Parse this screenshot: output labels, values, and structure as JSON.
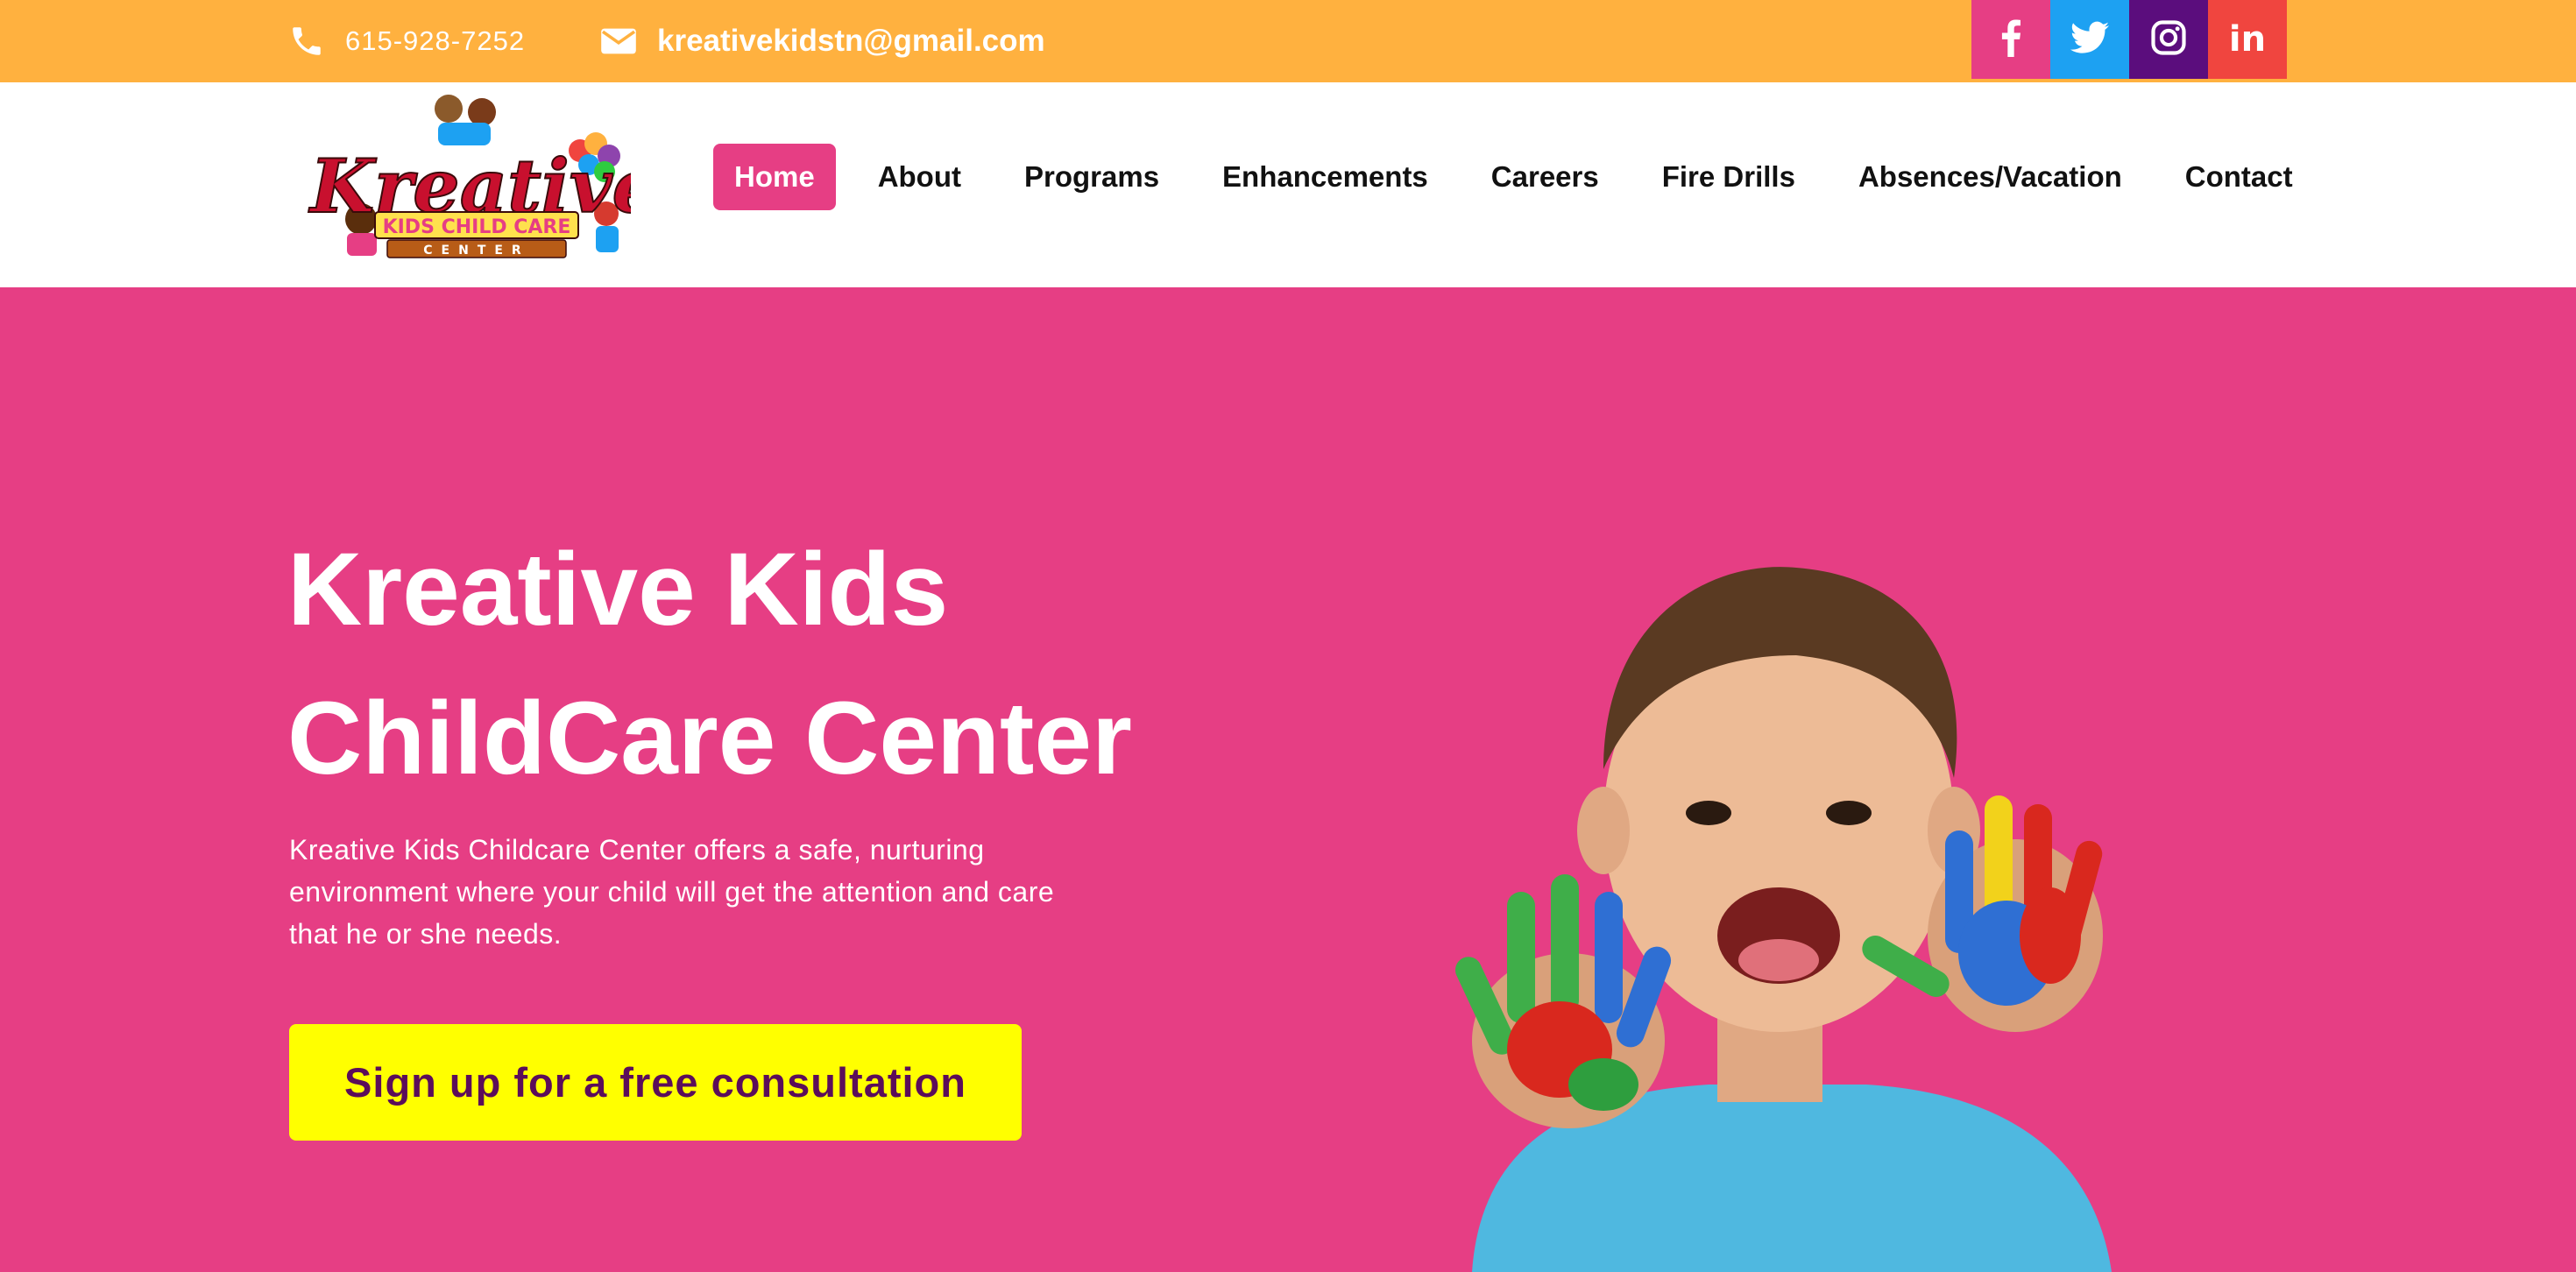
{
  "topbar": {
    "phone": "615-928-7252",
    "email": "kreativekidstn@gmail.com",
    "socials": [
      {
        "name": "facebook",
        "icon": "facebook-icon",
        "color": "#E63E84"
      },
      {
        "name": "twitter",
        "icon": "twitter-icon",
        "color": "#1DA1F2"
      },
      {
        "name": "instagram",
        "icon": "instagram-icon",
        "color": "#5B0D7D"
      },
      {
        "name": "linkedin",
        "icon": "linkedin-icon",
        "color": "#F0453F",
        "glyph": "in"
      }
    ],
    "background": "#FFB13F"
  },
  "logo": {
    "word": "Kreative",
    "line2": "KIDS CHILD CARE",
    "line3": "CENTER"
  },
  "nav": {
    "items": [
      {
        "label": "Home",
        "active": true
      },
      {
        "label": "About"
      },
      {
        "label": "Programs"
      },
      {
        "label": "Enhancements"
      },
      {
        "label": "Careers"
      },
      {
        "label": "Fire Drills"
      },
      {
        "label": "Absences/Vacation"
      },
      {
        "label": "Contact"
      }
    ],
    "active_color": "#E63E84"
  },
  "hero": {
    "title_line1": "Kreative Kids",
    "title_line2": "ChildCare Center",
    "description": "Kreative Kids Childcare Center offers a safe, nurturing environment where your child will get the attention and care that he or she needs.",
    "cta_label": "Sign up for a free consultation",
    "background": "#E63E84",
    "cta_color": "#FFFF00"
  }
}
